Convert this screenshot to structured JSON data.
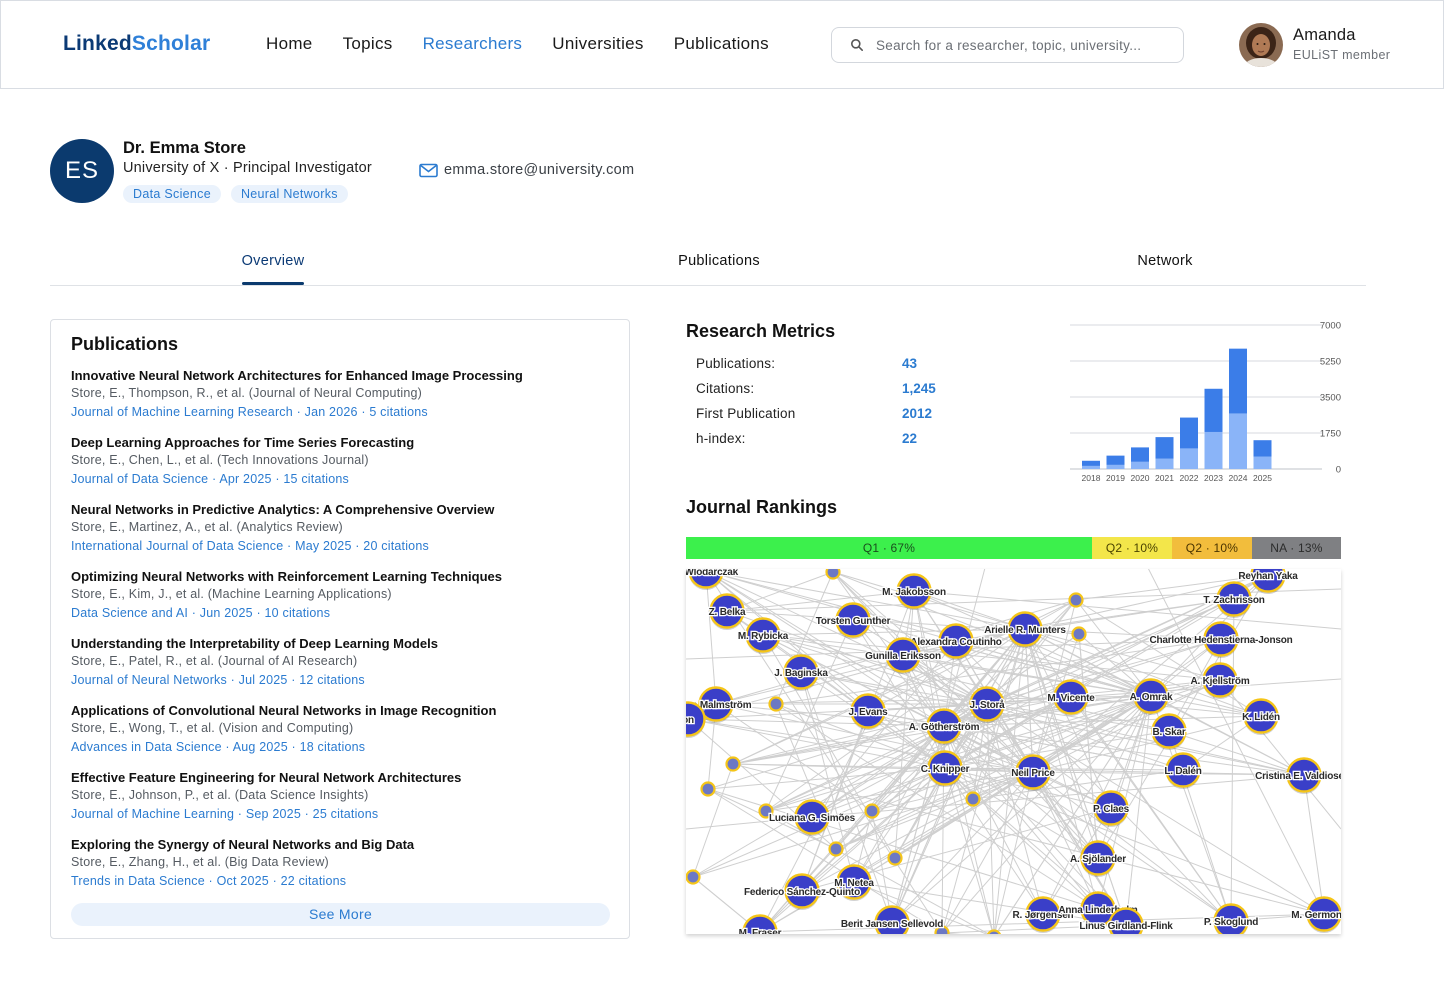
{
  "app": {
    "logo_part1": "Linked",
    "logo_part2": "Scholar"
  },
  "nav": {
    "items": [
      "Home",
      "Topics",
      "Researchers",
      "Universities",
      "Publications"
    ],
    "active": "Researchers"
  },
  "search": {
    "placeholder": "Search for a researcher, topic, university..."
  },
  "user": {
    "name": "Amanda",
    "role": "EULiST member"
  },
  "profile": {
    "initials": "ES",
    "name": "Dr. Emma Store",
    "affiliation": "University of X · Principal Investigator",
    "tags": [
      "Data Science",
      "Neural Networks"
    ],
    "email": "emma.store@university.com"
  },
  "tabs": [
    "Overview",
    "Publications",
    "Network"
  ],
  "publications": {
    "title": "Publications",
    "items": [
      {
        "title": "Innovative Neural Network Architectures for Enhanced Image Processing",
        "authors": "Store, E., Thompson, R., et al. (Journal of Neural Computing)",
        "journal": "Journal of Machine Learning Research · Jan 2026 · 5 citations"
      },
      {
        "title": "Deep Learning Approaches for Time Series Forecasting",
        "authors": "Store, E., Chen, L., et al. (Tech Innovations Journal)",
        "journal": "Journal of Data Science · Apr 2025 · 15 citations"
      },
      {
        "title": "Neural Networks in Predictive Analytics: A Comprehensive Overview",
        "authors": "Store, E., Martinez, A., et al. (Analytics Review)",
        "journal": "International Journal of Data Science · May 2025 · 20 citations"
      },
      {
        "title": "Optimizing Neural Networks with Reinforcement Learning Techniques",
        "authors": "Store, E., Kim, J., et al. (Machine Learning Applications)",
        "journal": "Data Science and AI · Jun 2025 · 10 citations"
      },
      {
        "title": "Understanding the Interpretability of Deep Learning Models",
        "authors": "Store, E., Patel, R., et al. (Journal of AI Research)",
        "journal": "Journal of Neural Networks · Jul 2025 · 12 citations"
      },
      {
        "title": "Applications of Convolutional Neural Networks in Image Recognition",
        "authors": "Store, E., Wong, T., et al. (Vision and Computing)",
        "journal": "Advances in Data Science · Aug 2025 · 18 citations"
      },
      {
        "title": "Effective Feature Engineering for Neural Network Architectures",
        "authors": "Store, E., Johnson, P., et al. (Data Science Insights)",
        "journal": "Journal of Machine Learning · Sep 2025 · 25 citations"
      },
      {
        "title": "Exploring the Synergy of Neural Networks and Big Data",
        "authors": "Store, E., Zhang, H., et al. (Big Data Review)",
        "journal": "Trends in Data Science · Oct 2025 · 22 citations"
      }
    ],
    "see_more": "See More"
  },
  "metrics": {
    "title": "Research Metrics",
    "rows": [
      {
        "label": "Publications:",
        "value": "43"
      },
      {
        "label": "Citations:",
        "value": "1,245"
      },
      {
        "label": "First Publication",
        "value": "2012"
      },
      {
        "label": "h-index:",
        "value": "22"
      }
    ]
  },
  "chart_data": {
    "type": "bar",
    "stacked": true,
    "categories": [
      "2018",
      "2019",
      "2020",
      "2021",
      "2022",
      "2023",
      "2024",
      "2025"
    ],
    "series": [
      {
        "values": [
          150,
          200,
          350,
          500,
          1000,
          1800,
          2700,
          600
        ],
        "color": "#8ab4f8"
      },
      {
        "values": [
          250,
          450,
          700,
          1050,
          1500,
          2100,
          3150,
          800
        ],
        "color": "#3b7de8"
      }
    ],
    "yticks": [
      0,
      1750,
      3500,
      5250,
      7000
    ],
    "ylim": [
      0,
      7000
    ],
    "grid": false
  },
  "rankings": {
    "title": "Journal Rankings",
    "segments": [
      {
        "label": "Q1 · 67%",
        "percent": 62,
        "color": "#3cf04c",
        "text": "#1a4d1d"
      },
      {
        "label": "Q2 · 10%",
        "percent": 12.2,
        "color": "#f3e64a",
        "text": "#4a4300"
      },
      {
        "label": "Q2 · 10%",
        "percent": 12.2,
        "color": "#f2bd3c",
        "text": "#4a3400"
      },
      {
        "label": "NA · 13%",
        "percent": 13.6,
        "color": "#7f8083",
        "text": "#2c2c2c"
      }
    ]
  },
  "network": {
    "nodes": [
      {
        "label": "M. Jakobsson"
      },
      {
        "label": "Torsten Gunther"
      },
      {
        "label": "Alexandra Coutinho"
      },
      {
        "label": "Gunilla Eriksson"
      },
      {
        "label": "Arielle R. Munters"
      },
      {
        "label": "Z. Belka"
      },
      {
        "label": "M. Rybicka"
      },
      {
        "label": "J. Baginska"
      },
      {
        "label": "ena Malmström"
      },
      {
        "label": "P. Wlodarczak"
      },
      {
        "label": "J. Evans"
      },
      {
        "label": "J. Storå"
      },
      {
        "label": "A. Götherström"
      },
      {
        "label": "M. Vicente"
      },
      {
        "label": "A. Omrak"
      },
      {
        "label": "A. Kjellström"
      },
      {
        "label": "K. Lidén"
      },
      {
        "label": "B. Skar"
      },
      {
        "label": "Reyhan Yaka"
      },
      {
        "label": "T. Zachrisson"
      },
      {
        "label": "Charlotte Hedenstierna-Jonson"
      },
      {
        "label": "C. Knipper"
      },
      {
        "label": "Neil Price"
      },
      {
        "label": "L. Dalén"
      },
      {
        "label": "Cristina E. Valdiosera"
      },
      {
        "label": "Luciana G. Simões"
      },
      {
        "label": "P. Claes"
      },
      {
        "label": "A. Sjölander"
      },
      {
        "label": "M. Netea"
      },
      {
        "label": "Federico Sánchez-Quinto"
      },
      {
        "label": "Berit Jansen Sellevold"
      },
      {
        "label": "R. Jørgensen"
      },
      {
        "label": "Anna Linderholm"
      },
      {
        "label": "Linus Girdland-Flink"
      },
      {
        "label": "P. Skoglund"
      },
      {
        "label": "M. Germonpré"
      },
      {
        "label": "M. Fraser"
      },
      {
        "label": "on"
      }
    ]
  }
}
